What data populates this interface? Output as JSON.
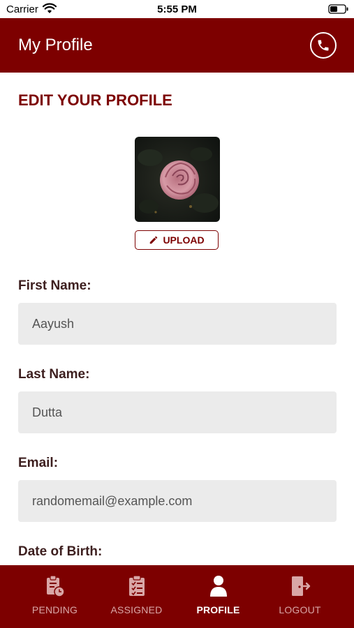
{
  "status_bar": {
    "carrier": "Carrier",
    "time": "5:55 PM"
  },
  "header": {
    "title": "My Profile"
  },
  "profile": {
    "heading": "EDIT YOUR PROFILE",
    "upload_label": "UPLOAD",
    "fields": [
      {
        "label": "First Name:",
        "value": "Aayush"
      },
      {
        "label": "Last Name:",
        "value": "Dutta"
      },
      {
        "label": "Email:",
        "value": "randomemail@example.com"
      },
      {
        "label": "Date of Birth:"
      }
    ]
  },
  "tabs": [
    {
      "label": "PENDING",
      "icon": "clipboard-clock-icon"
    },
    {
      "label": "ASSIGNED",
      "icon": "clipboard-check-icon"
    },
    {
      "label": "PROFILE",
      "icon": "user-icon",
      "active": true
    },
    {
      "label": "LOGOUT",
      "icon": "logout-icon"
    }
  ],
  "colors": {
    "primary": "#7d0000",
    "input_bg": "#ebebeb",
    "label": "#3d1f1f"
  }
}
